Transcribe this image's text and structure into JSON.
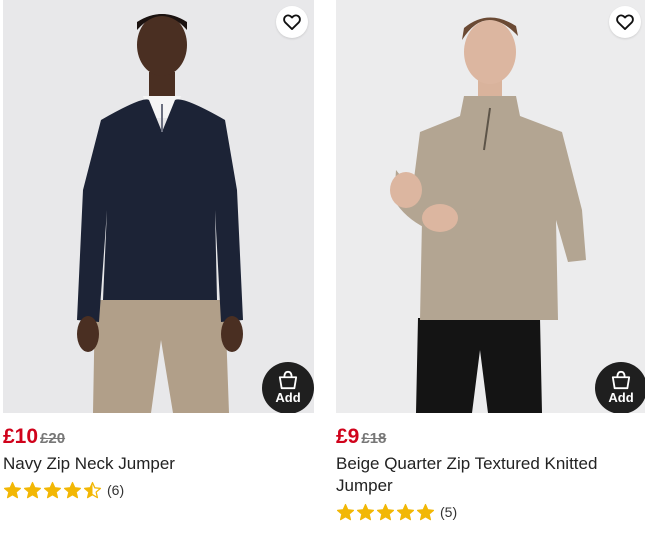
{
  "products": [
    {
      "price_now": "£10",
      "price_was": "£20",
      "name": "Navy Zip Neck Jumper",
      "rating": 4.5,
      "review_count": "(6)",
      "add_label": "Add"
    },
    {
      "price_now": "£9",
      "price_was": "£18",
      "name": "Beige Quarter Zip Textured Knitted Jumper",
      "rating": 5,
      "review_count": "(5)",
      "add_label": "Add"
    }
  ],
  "colors": {
    "sale_price": "#d0021b",
    "star": "#f2b705",
    "add_button": "#1f1f1f"
  },
  "icons": {
    "wishlist": "heart-outline-icon",
    "add": "basket-icon",
    "rating": "star-icon"
  }
}
